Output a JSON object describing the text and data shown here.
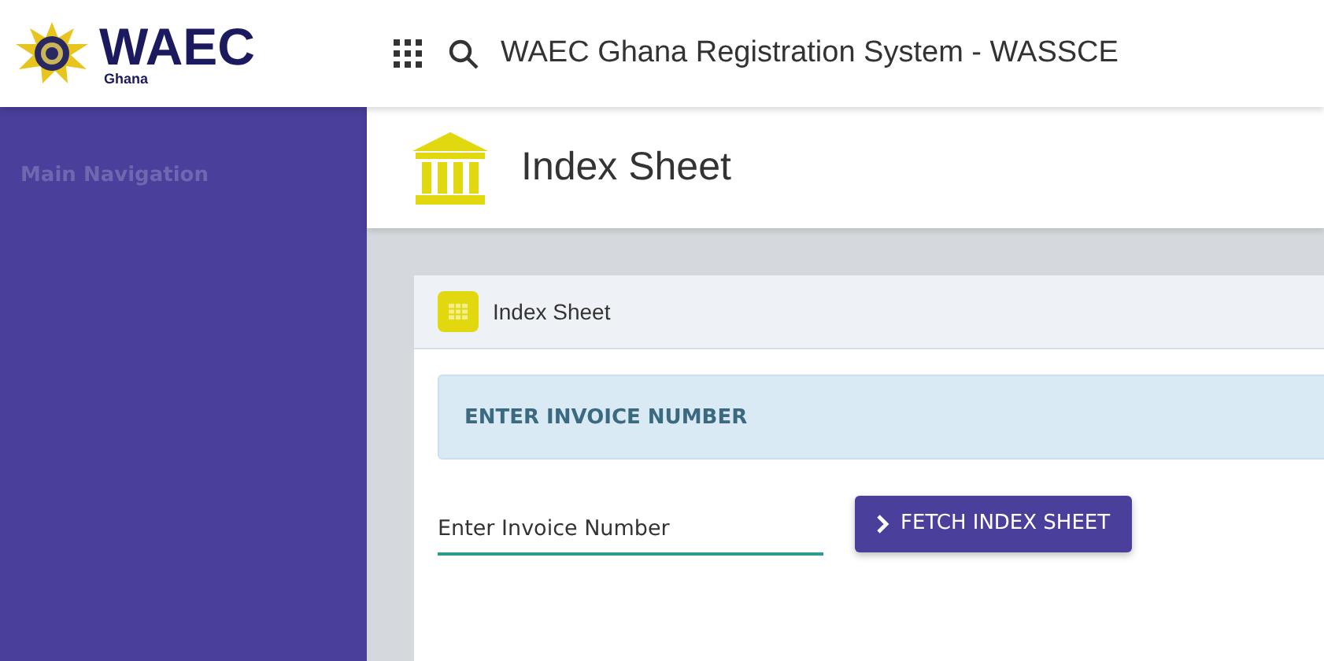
{
  "header": {
    "logo_text": "WAEC",
    "logo_subtext": "Ghana",
    "title": "WAEC Ghana Registration System - WASSCE"
  },
  "sidebar": {
    "heading": "Main Navigation"
  },
  "page": {
    "title": "Index Sheet"
  },
  "card": {
    "title": "Index Sheet",
    "alert": "ENTER INVOICE NUMBER",
    "invoice_field": {
      "placeholder": "Enter Invoice Number"
    },
    "button": "FETCH INDEX SHEET"
  }
}
